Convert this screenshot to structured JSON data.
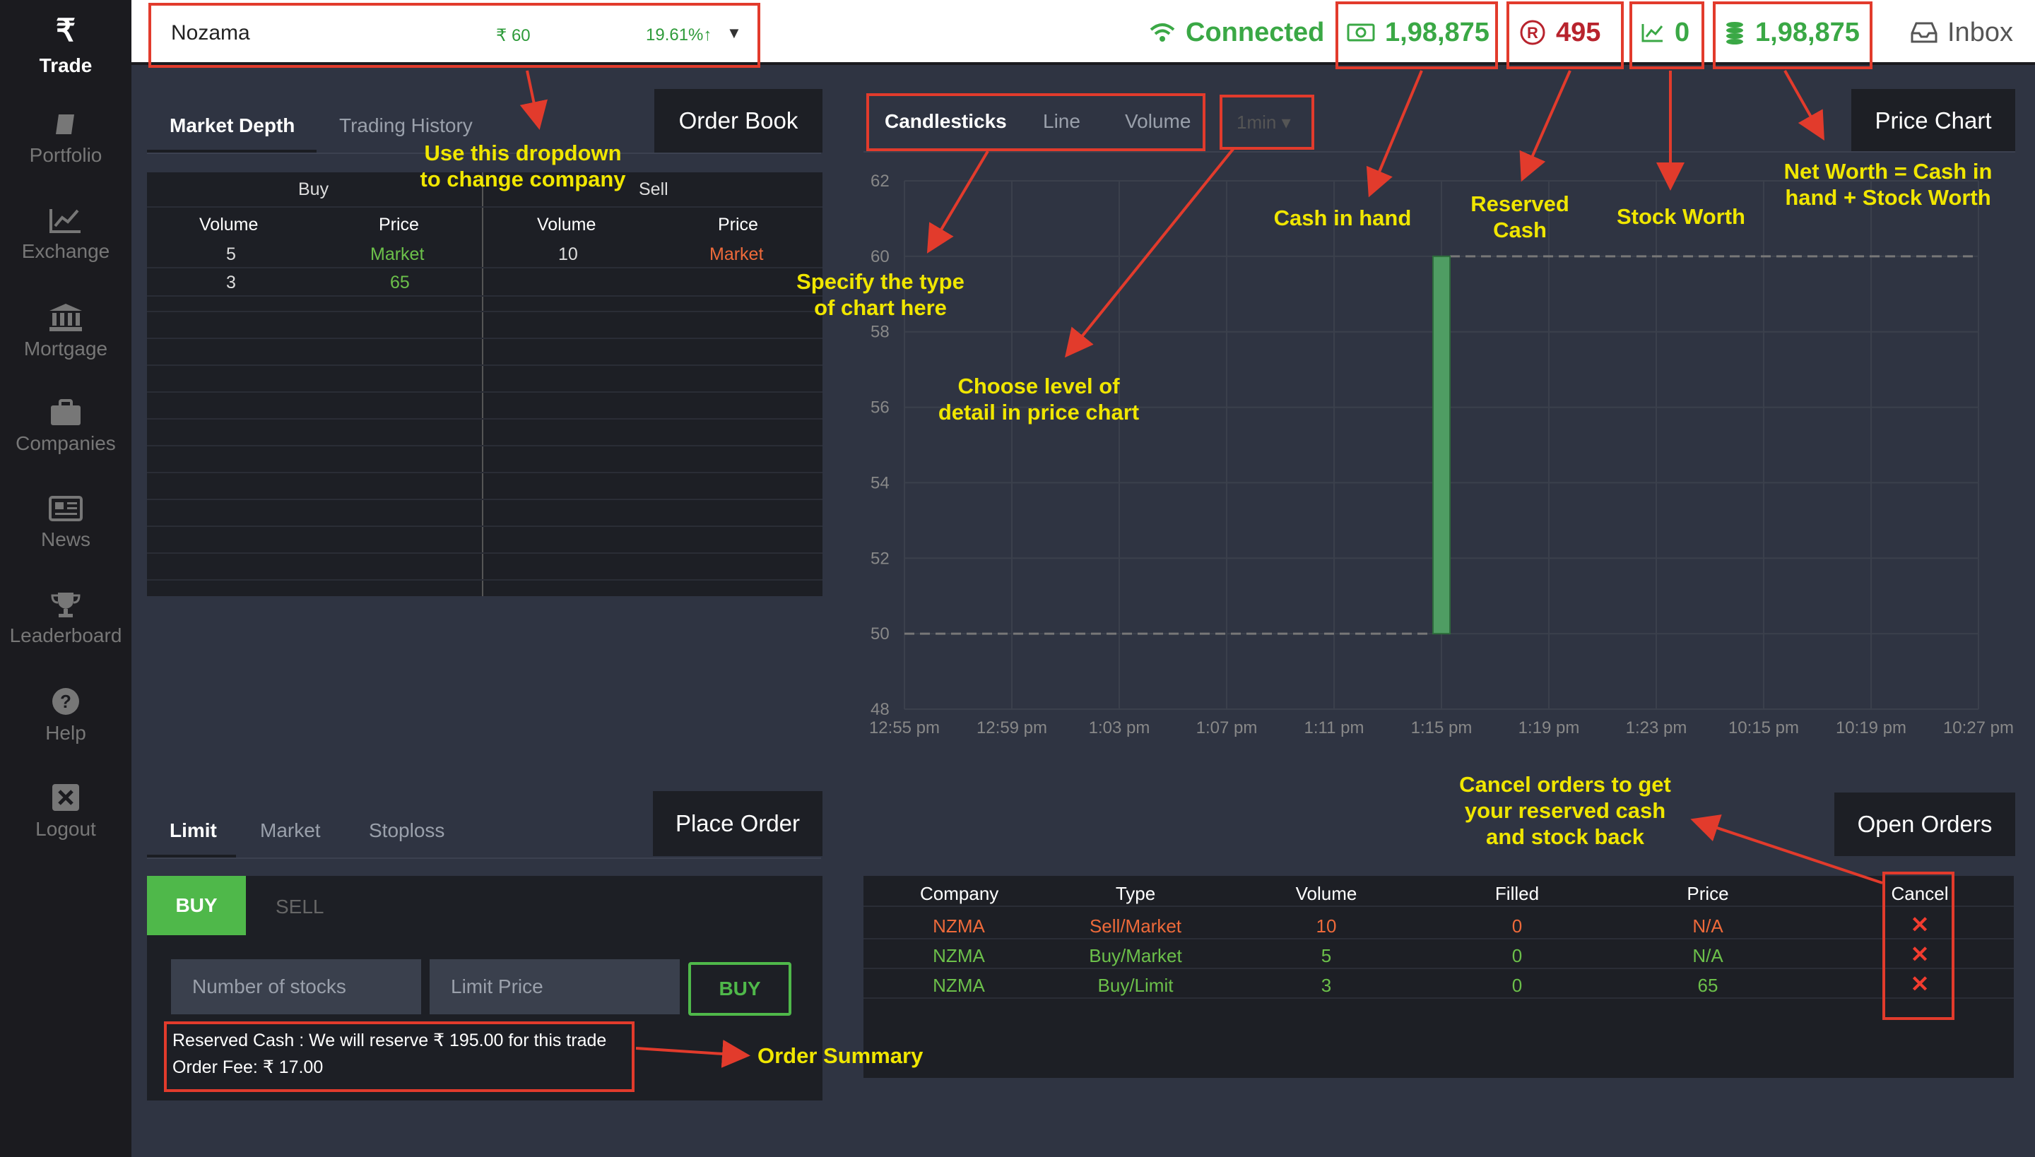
{
  "sidebar": {
    "items": [
      {
        "label": "Trade",
        "icon": "rupee-icon"
      },
      {
        "label": "Portfolio",
        "icon": "book-icon"
      },
      {
        "label": "Exchange",
        "icon": "line-chart-icon"
      },
      {
        "label": "Mortgage",
        "icon": "bank-icon"
      },
      {
        "label": "Companies",
        "icon": "briefcase-icon"
      },
      {
        "label": "News",
        "icon": "newspaper-icon"
      },
      {
        "label": "Leaderboard",
        "icon": "trophy-icon"
      },
      {
        "label": "Help",
        "icon": "question-icon"
      },
      {
        "label": "Logout",
        "icon": "close-box-icon"
      }
    ]
  },
  "topbar": {
    "company": "Nozama",
    "price": "₹ 60",
    "change": "19.61%↑",
    "status": "Connected",
    "cash_in_hand": "1,98,875",
    "reserved_cash": "495",
    "stock_worth": "0",
    "net_worth": "1,98,875",
    "inbox": "Inbox"
  },
  "order_book": {
    "tabs": [
      "Market Depth",
      "Trading History"
    ],
    "title": "Order Book",
    "buy_header": "Buy",
    "sell_header": "Sell",
    "col_volume": "Volume",
    "col_price": "Price",
    "buy_rows": [
      {
        "volume": "5",
        "price": "Market"
      },
      {
        "volume": "3",
        "price": "65"
      }
    ],
    "sell_rows": [
      {
        "volume": "10",
        "price": "Market"
      }
    ]
  },
  "price_chart": {
    "tabs": [
      "Candlesticks",
      "Line",
      "Volume"
    ],
    "interval": "1min ▾",
    "title": "Price Chart"
  },
  "chart_data": {
    "type": "candlestick",
    "title": "",
    "xlabel": "",
    "ylabel": "",
    "ylim": [
      48,
      62
    ],
    "y_ticks": [
      "62",
      "60",
      "58",
      "56",
      "54",
      "52",
      "50",
      "48"
    ],
    "x_ticks": [
      "12:55 pm",
      "12:59 pm",
      "1:03 pm",
      "1:07 pm",
      "1:11 pm",
      "1:15 pm",
      "1:19 pm",
      "1:23 pm",
      "10:15 pm",
      "10:19 pm",
      "10:27 pm"
    ],
    "candles": [
      {
        "x": "1:15 pm",
        "open": 50,
        "close": 60,
        "low": 50,
        "high": 60
      }
    ],
    "reference_lines": [
      50,
      60
    ],
    "grid": true,
    "colors": {
      "up": "#4f9d63",
      "reference": "#777777"
    }
  },
  "place_order": {
    "tabs": [
      "Limit",
      "Market",
      "Stoploss"
    ],
    "title": "Place Order",
    "side_buy": "BUY",
    "side_sell": "SELL",
    "stocks_placeholder": "Number of stocks",
    "limit_placeholder": "Limit Price",
    "submit": "BUY",
    "summary_line1": "Reserved Cash : We will reserve ₹ 195.00 for this trade",
    "summary_line2": "Order Fee: ₹ 17.00"
  },
  "open_orders": {
    "title": "Open Orders",
    "headers": [
      "Company",
      "Type",
      "Volume",
      "Filled",
      "Price",
      "Cancel"
    ],
    "rows": [
      {
        "company": "NZMA",
        "type": "Sell/Market",
        "volume": "10",
        "filled": "0",
        "price": "N/A",
        "side": "sell"
      },
      {
        "company": "NZMA",
        "type": "Buy/Market",
        "volume": "5",
        "filled": "0",
        "price": "N/A",
        "side": "buy"
      },
      {
        "company": "NZMA",
        "type": "Buy/Limit",
        "volume": "3",
        "filled": "0",
        "price": "65",
        "side": "buy"
      }
    ],
    "cancel_glyph": "✕"
  },
  "annotations": {
    "dropdown_line1": "Use this dropdown",
    "dropdown_line2": "to change company",
    "chart_type_line1": "Specify the type",
    "chart_type_line2": "of chart here",
    "detail_line1": "Choose level of",
    "detail_line2": "detail in price chart",
    "cash": "Cash in hand",
    "reserved_line1": "Reserved",
    "reserved_line2": "Cash",
    "stock_worth": "Stock Worth",
    "net_line1": "Net Worth = Cash in",
    "net_line2": "hand + Stock Worth",
    "cancel_line1": "Cancel orders to get",
    "cancel_line2": "your reserved cash",
    "cancel_line3": "and stock back",
    "summary": "Order Summary"
  },
  "colors": {
    "green": "#6cc04a",
    "red": "#ee6a3a",
    "annotation": "#f0e600",
    "callout": "#e23b2c"
  }
}
